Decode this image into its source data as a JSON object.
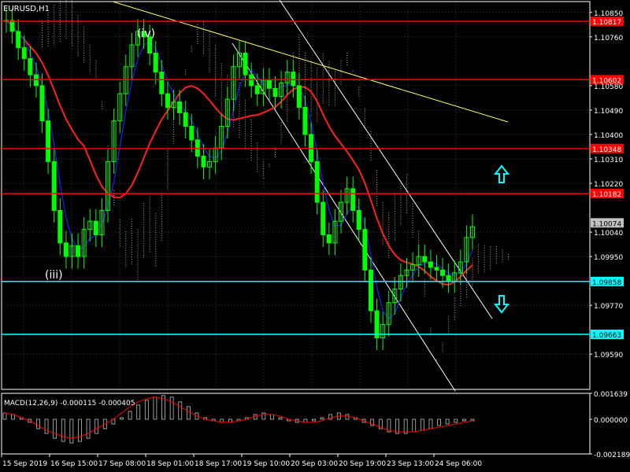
{
  "symbol_title": "EURUSD,H1",
  "indicator_title": "MACD(12,26,9) -0.000115 -0.000405",
  "wave_labels": [
    "(iv)",
    "(iii)"
  ],
  "colors": {
    "background": "#000000",
    "candle": "#00ff00",
    "grid": "#ffffff",
    "resistance": "#ff0000",
    "support": "#00ffff",
    "trendline": "#ffff66",
    "channel": "#ffffff",
    "ma_red": "#ff2020",
    "ma_blue": "#2020ff",
    "ichimoku_cloud": "#ffcc99",
    "macd_signal": "#ff0000",
    "macd_hist": "#c0c0c0",
    "arrow": "#00ffff"
  },
  "icons": [
    "arrow-up-icon",
    "arrow-down-icon"
  ],
  "chart_data": [
    {
      "type": "candlestick",
      "title": "EURUSD,H1",
      "x_ticks": [
        "15 Sep 2019",
        "16 Sep 15:00",
        "17 Sep 08:00",
        "18 Sep 01:00",
        "18 Sep 17:00",
        "19 Sep 10:00",
        "20 Sep 03:00",
        "20 Sep 19:00",
        "23 Sep 13:00",
        "24 Sep 06:00"
      ],
      "y_ticks": [
        1.1085,
        1.1076,
        1.1058,
        1.1049,
        1.104,
        1.1031,
        1.1022,
        1.1004,
        1.0995,
        1.0977,
        1.0959
      ],
      "ylim": [
        1.0946,
        1.1089
      ],
      "grid": true,
      "price_levels": [
        {
          "value": "1.10817",
          "kind": "resistance"
        },
        {
          "value": "1.10602",
          "kind": "resistance"
        },
        {
          "value": "1.10348",
          "kind": "resistance"
        },
        {
          "value": "1.10182",
          "kind": "resistance"
        },
        {
          "value": "1.09858",
          "kind": "support"
        },
        {
          "value": "1.09663",
          "kind": "support"
        }
      ],
      "current_price": "1.10074",
      "close_series": [
        1.1082,
        1.1078,
        1.1072,
        1.1068,
        1.1062,
        1.1058,
        1.1045,
        1.103,
        1.1012,
        1.1,
        1.0995,
        1.0999,
        1.0995,
        1.1005,
        1.1008,
        1.1003,
        1.1012,
        1.103,
        1.1045,
        1.1055,
        1.1065,
        1.1073,
        1.1078,
        1.1076,
        1.107,
        1.1063,
        1.1055,
        1.105,
        1.1052,
        1.1048,
        1.1043,
        1.1038,
        1.1032,
        1.1028,
        1.103,
        1.1035,
        1.1043,
        1.1053,
        1.1065,
        1.107,
        1.1062,
        1.1058,
        1.1055,
        1.106,
        1.1057,
        1.1054,
        1.1059,
        1.1063,
        1.1058,
        1.105,
        1.104,
        1.103,
        1.1015,
        1.1003,
        1.1,
        1.1008,
        1.1015,
        1.102,
        1.1012,
        1.1005,
        1.099,
        1.0975,
        1.0965,
        1.097,
        1.0978,
        1.0983,
        1.0988,
        1.099,
        1.0992,
        1.0995,
        1.0993,
        1.0991,
        1.099,
        1.0988,
        1.0986,
        1.0989,
        1.0993,
        1.1002,
        1.1006
      ],
      "macd": {
        "ylim": [
          -0.002189,
          0.001639
        ],
        "y_ticks": [
          0.001639,
          0.0,
          -0.002189
        ],
        "histogram": [
          0.0004,
          0.0003,
          0.0001,
          -0.0002,
          -0.0006,
          -0.0009,
          -0.0012,
          -0.0014,
          -0.0015,
          -0.0014,
          -0.0012,
          -0.0009,
          -0.0006,
          -0.0003,
          0.0001,
          0.0005,
          0.0009,
          0.0012,
          0.0014,
          0.0015,
          0.0014,
          0.0011,
          0.0008,
          0.0004,
          0.0001,
          -0.0001,
          -0.0002,
          -0.0002,
          -0.0001,
          0.0001,
          0.0003,
          0.0004,
          0.0003,
          0.0001,
          -0.0001,
          -0.0002,
          -0.0002,
          -0.0001,
          0.0001,
          0.0003,
          0.0004,
          0.0003,
          0.0001,
          -0.0002,
          -0.0004,
          -0.0006,
          -0.0008,
          -0.0009,
          -0.0009,
          -0.0008,
          -0.0007,
          -0.0006,
          -0.0004,
          -0.0003,
          -0.0002,
          -0.0001,
          -0.0001
        ],
        "signal": [
          0.0004,
          0.0003,
          0.0001,
          -0.0001,
          -0.0004,
          -0.0007,
          -0.0009,
          -0.0011,
          -0.0012,
          -0.0011,
          -0.0009,
          -0.0006,
          -0.0003,
          0.0,
          0.0004,
          0.0008,
          0.0011,
          0.0013,
          0.0014,
          0.0013,
          0.0011,
          0.0008,
          0.0005,
          0.0002,
          0.0,
          -0.0001,
          -0.0002,
          -0.0002,
          -0.0001,
          0.0,
          0.0002,
          0.0003,
          0.0003,
          0.0002,
          0.0,
          -0.0001,
          -0.0002,
          -0.0002,
          -0.0001,
          0.0001,
          0.0002,
          0.0002,
          0.0001,
          -0.0001,
          -0.0003,
          -0.0005,
          -0.0007,
          -0.0008,
          -0.0008,
          -0.0008,
          -0.0007,
          -0.0006,
          -0.0005,
          -0.0004,
          -0.0003,
          -0.0002,
          -0.0001
        ]
      }
    }
  ]
}
